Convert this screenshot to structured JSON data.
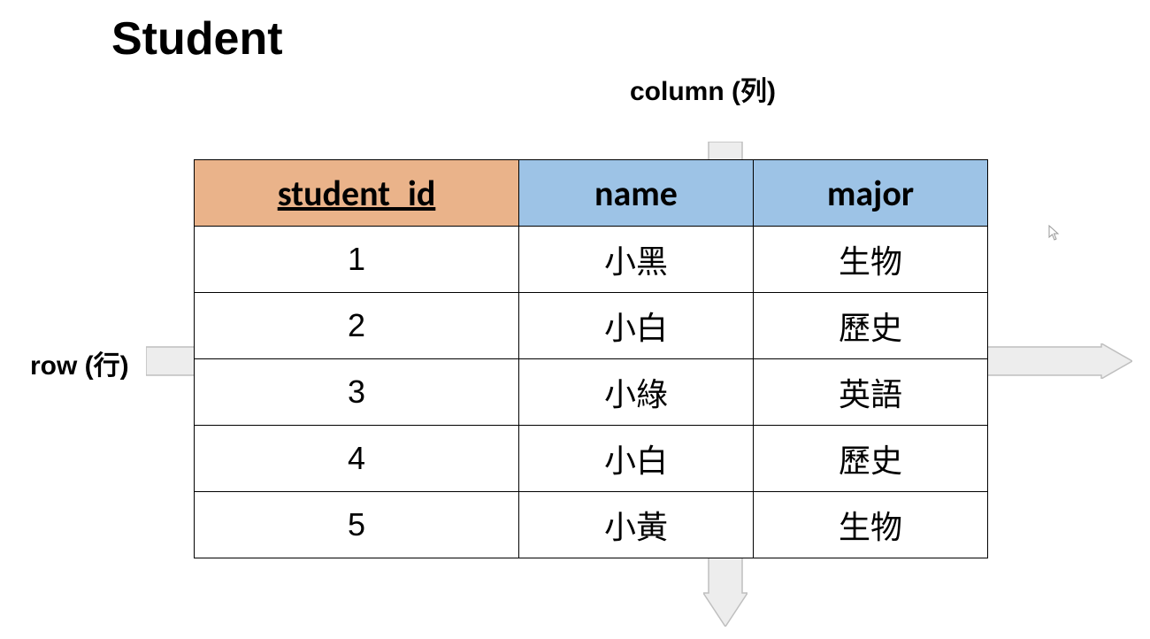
{
  "title": "Student",
  "labels": {
    "column": "column (列)",
    "row": "row (行)"
  },
  "headers": [
    "student_id",
    "name",
    "major"
  ],
  "rows": [
    {
      "id": "1",
      "name": "小黑",
      "major": "生物"
    },
    {
      "id": "2",
      "name": "小白",
      "major": "歷史"
    },
    {
      "id": "3",
      "name": "小綠",
      "major": "英語"
    },
    {
      "id": "4",
      "name": "小白",
      "major": "歷史"
    },
    {
      "id": "5",
      "name": "小黃",
      "major": "生物"
    }
  ],
  "chart_data": {
    "type": "table",
    "title": "Student",
    "columns": [
      "student_id",
      "name",
      "major"
    ],
    "primary_key": "student_id",
    "rows": [
      [
        1,
        "小黑",
        "生物"
      ],
      [
        2,
        "小白",
        "歷史"
      ],
      [
        3,
        "小綠",
        "英語"
      ],
      [
        4,
        "小白",
        "歷史"
      ],
      [
        5,
        "小黃",
        "生物"
      ]
    ],
    "annotations": {
      "column_label": "column (列)",
      "row_label": "row (行)"
    }
  }
}
